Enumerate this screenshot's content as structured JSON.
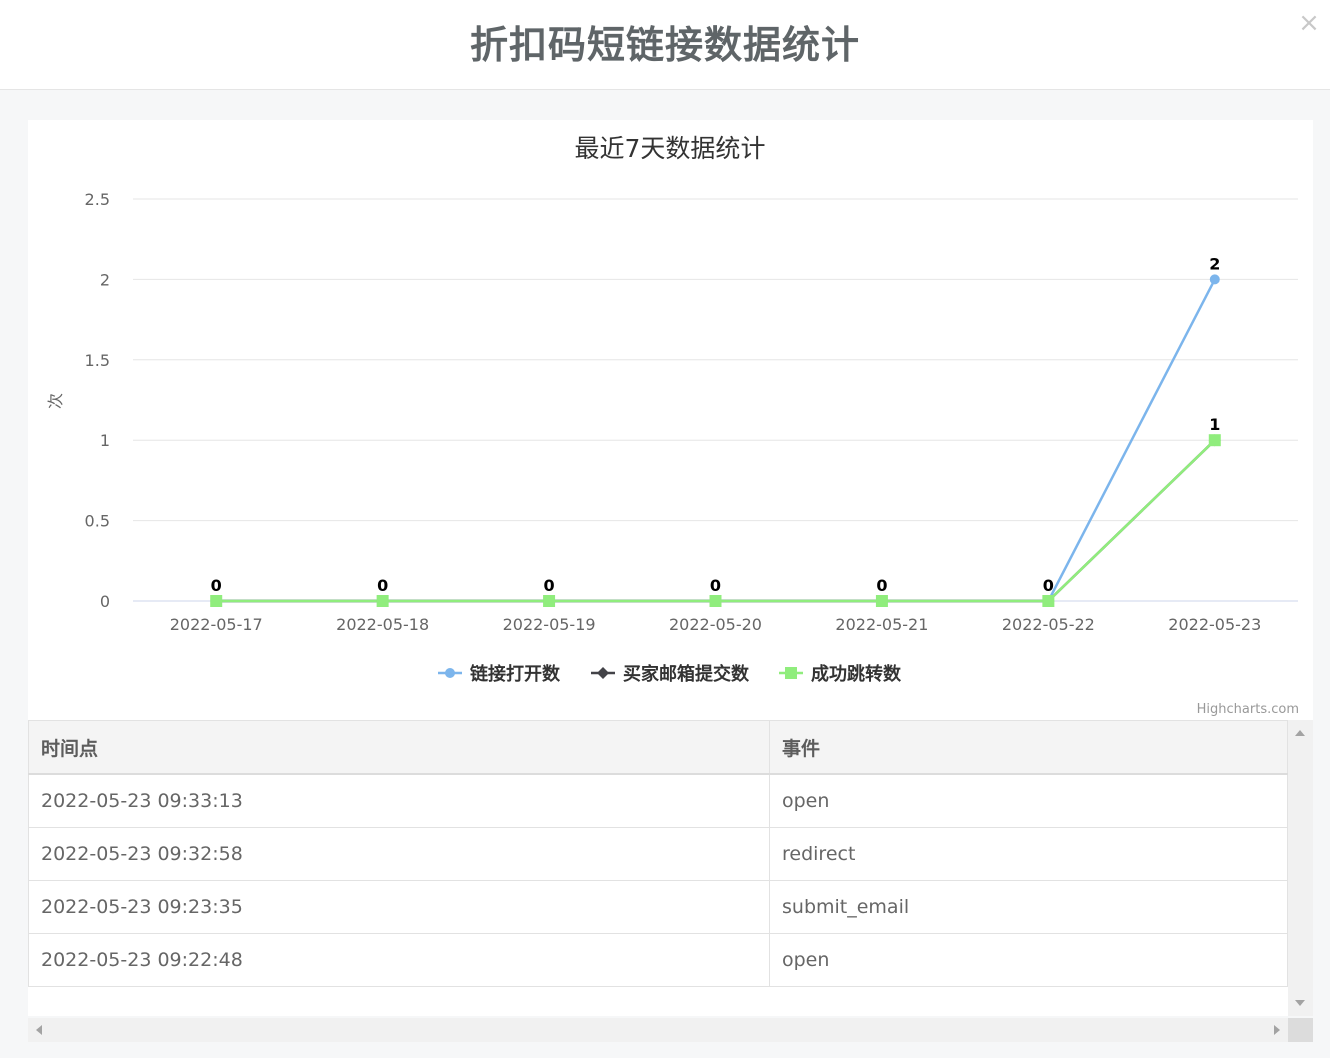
{
  "modal": {
    "title": "折扣码短链接数据统计",
    "close_label": "×"
  },
  "chart_data": {
    "type": "line",
    "title": "最近7天数据统计",
    "xlabel": "",
    "ylabel": "次",
    "categories": [
      "2022-05-17",
      "2022-05-18",
      "2022-05-19",
      "2022-05-20",
      "2022-05-21",
      "2022-05-22",
      "2022-05-23"
    ],
    "ylim": [
      0,
      2.5
    ],
    "yticks": [
      "0",
      "0.5",
      "1",
      "1.5",
      "2",
      "2.5"
    ],
    "grid": true,
    "legend_position": "bottom-center",
    "series": [
      {
        "name": "链接打开数",
        "values": [
          0,
          0,
          0,
          0,
          0,
          0,
          2
        ],
        "color": "#7cb5ec",
        "marker": "circle"
      },
      {
        "name": "买家邮箱提交数",
        "values": [
          0,
          0,
          0,
          0,
          0,
          0,
          1
        ],
        "color": "#434348",
        "marker": "diamond"
      },
      {
        "name": "成功跳转数",
        "values": [
          0,
          0,
          0,
          0,
          0,
          0,
          1
        ],
        "color": "#90ed7d",
        "marker": "square"
      }
    ],
    "data_labels": [
      "0",
      "0",
      "0",
      "0",
      "0",
      "0",
      "2",
      "1"
    ],
    "credits": "Highcharts.com"
  },
  "table": {
    "headers": [
      "时间点",
      "事件"
    ],
    "rows": [
      [
        "2022-05-23 09:33:13",
        "open"
      ],
      [
        "2022-05-23 09:32:58",
        "redirect"
      ],
      [
        "2022-05-23 09:23:35",
        "submit_email"
      ],
      [
        "2022-05-23 09:22:48",
        "open"
      ]
    ]
  }
}
